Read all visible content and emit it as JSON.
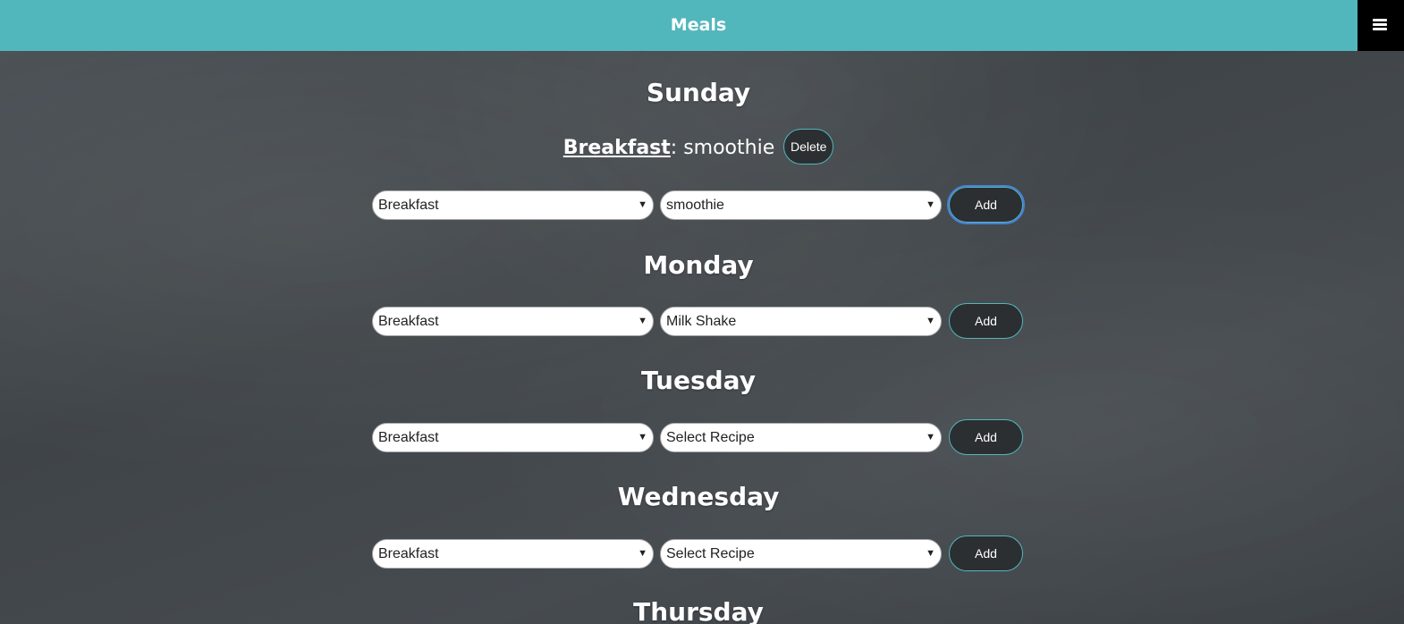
{
  "header": {
    "title": "Meals",
    "menu_icon": "hamburger-menu-icon"
  },
  "days": [
    {
      "name": "Sunday",
      "meals": [
        {
          "type": "Breakfast",
          "separator": ": ",
          "recipe": "smoothie",
          "delete_label": "Delete"
        }
      ],
      "form": {
        "meal_type": "Breakfast",
        "recipe": "smoothie",
        "add_label": "Add"
      }
    },
    {
      "name": "Monday",
      "meals": [],
      "form": {
        "meal_type": "Breakfast",
        "recipe": "Milk Shake",
        "add_label": "Add"
      }
    },
    {
      "name": "Tuesday",
      "meals": [],
      "form": {
        "meal_type": "Breakfast",
        "recipe": "Select Recipe",
        "add_label": "Add"
      }
    },
    {
      "name": "Wednesday",
      "meals": [],
      "form": {
        "meal_type": "Breakfast",
        "recipe": "Select Recipe",
        "add_label": "Add"
      }
    },
    {
      "name": "Thursday",
      "meals": [],
      "form": null
    }
  ],
  "colors": {
    "header_bg": "#52b7bd",
    "button_bg": "#2b2f31",
    "button_border": "#52b7bd",
    "menu_bg": "#000000"
  }
}
